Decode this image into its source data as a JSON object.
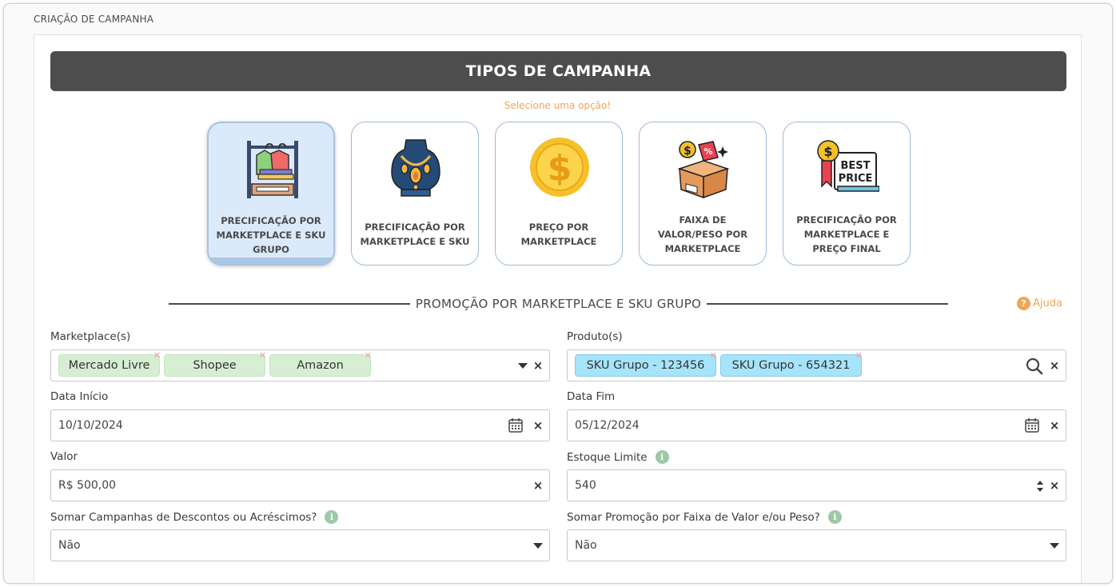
{
  "page": {
    "title": "CRIAÇÃO DE CAMPANHA"
  },
  "banner": {
    "title": "TIPOS DE CAMPANHA",
    "subtitle": "Selecione uma opção!"
  },
  "campaign_types": [
    {
      "label": "PRECIFICAÇÃO POR MARKETPLACE E SKU GRUPO",
      "icon": "clothes-rack-icon",
      "selected": true
    },
    {
      "label": "PRECIFICAÇÃO POR MARKETPLACE E SKU",
      "icon": "jewelry-necklace-icon",
      "selected": false
    },
    {
      "label": "PREÇO POR MARKETPLACE",
      "icon": "dollar-coin-icon",
      "selected": false
    },
    {
      "label": "FAIXA DE VALOR/PESO POR MARKETPLACE",
      "icon": "discount-box-icon",
      "selected": false
    },
    {
      "label": "PRECIFICAÇÃO POR MARKETPLACE E PREÇO FINAL",
      "icon": "best-price-tag-icon",
      "selected": false
    }
  ],
  "section": {
    "title": "PROMOÇÃO POR MARKETPLACE E SKU GRUPO",
    "help_label": "Ajuda"
  },
  "form": {
    "marketplaces": {
      "label": "Marketplace(s)",
      "tags": [
        "Mercado Livre",
        "Shopee",
        "Amazon"
      ]
    },
    "produtos": {
      "label": "Produto(s)",
      "tags": [
        "SKU Grupo - 123456",
        "SKU Grupo - 654321"
      ]
    },
    "data_inicio": {
      "label": "Data Início",
      "value": "10/10/2024"
    },
    "data_fim": {
      "label": "Data Fim",
      "value": "05/12/2024"
    },
    "valor": {
      "label": "Valor",
      "value": "R$ 500,00"
    },
    "estoque_limite": {
      "label": "Estoque Limite",
      "value": "540"
    },
    "somar_campanhas": {
      "label": "Somar Campanhas de Descontos ou Acréscimos?",
      "value": "Não"
    },
    "somar_promocao": {
      "label": "Somar Promoção por Faixa de Valor e/ou Peso?",
      "value": "Não"
    }
  },
  "colors": {
    "accent": "#f0a656",
    "banner": "#4d4d4d",
    "selected_card": "#dbeafb",
    "tag_green": "#d6efd3",
    "tag_blue": "#a6e4fb",
    "info": "#9ec8a6"
  }
}
